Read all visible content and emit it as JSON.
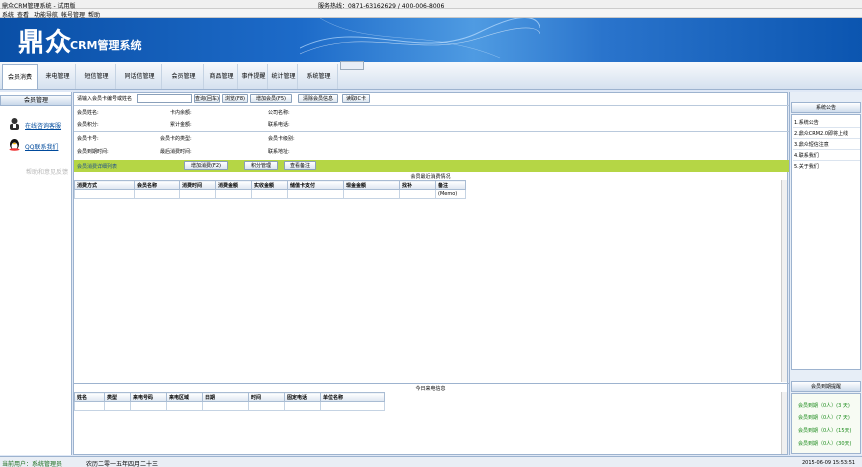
{
  "window": {
    "title": "鼎众CRM管理系统 - 试用版",
    "hotline": "服务热线：0871-63162629 / 400-006-8006"
  },
  "menu": [
    "系统",
    "查看",
    "功能导航",
    "帐号管理",
    "帮助"
  ],
  "banner": {
    "logo_cn": "鼎众",
    "logo_en": "CRM管理系统"
  },
  "tabs": [
    "会员消费",
    "来电管理",
    "短信管理",
    "同话信管理",
    "会员管理",
    "商品管理",
    "事件提醒",
    "统计管理",
    "系统管理"
  ],
  "left": {
    "header": "会员管理",
    "online_service": "在线咨询客服",
    "qq_contact": "QQ联系我们",
    "extra": "帮助和意见反馈"
  },
  "main": {
    "search_label": "请输入会员卡编号或姓名",
    "search_value": "",
    "buttons": {
      "query": "查询(回车)",
      "refresh": "浏览(F8)",
      "add_member": "增加会员(F5)",
      "clear": "清除会员信息",
      "read_card": "读取IC卡"
    },
    "info_row1": {
      "name": "会员姓名:",
      "balance": "卡内余额:",
      "company": "公司名称:"
    },
    "info_row2": {
      "points": "会员积分:",
      "total": "累计金额:",
      "phone": "联系电话:"
    },
    "info_row3": {
      "card_no": "会员卡号:",
      "card_type": "会员卡的类型:",
      "card_level": "会员卡级别:"
    },
    "info_row4": {
      "expire": "会员到期时间:",
      "last_time": "最后消费时间:",
      "address": "联系地址:"
    },
    "consume_list_title": "会员消费详细列表",
    "consume_buttons": {
      "add": "增加消费(F2)",
      "points_mgmt": "积分管理",
      "view_note": "查看备注"
    },
    "consume_grid_title": "会员最近消费情况",
    "consume_columns": [
      "消费方式",
      "会员名称",
      "消费时间",
      "消费金额",
      "实收金额",
      "储值卡支付",
      "现金金额",
      "找补",
      "备注"
    ],
    "consume_row": [
      "",
      "",
      "",
      "",
      "",
      "",
      "",
      "",
      "(Memo)"
    ],
    "calls_grid_title": "今日来电信息",
    "calls_columns": [
      "姓名",
      "类型",
      "来电号码",
      "来电区域",
      "日期",
      "时间",
      "固定电话",
      "单位名称"
    ]
  },
  "right": {
    "notice_header": "系统公告",
    "notices": [
      "1.系统公告",
      "2.鼎众CRM2.0即将上线",
      "3.鼎众短信注意",
      "4.联系我们",
      "5.关于我们"
    ],
    "expiry_header": "会员到期提醒",
    "expiry": [
      "会员到期（0人）(3 天)",
      "会员到期（0人）(7 天)",
      "会员到期（0人）(15天)",
      "会员到期（0人）(30天)"
    ]
  },
  "status": {
    "user": "当前用户：系统管理员",
    "lunar": "农历二零一五年四月二十三",
    "datetime": "2015-06-09 15:53:51"
  },
  "colors": {
    "banner": "#1d6bc9",
    "green_bar": "#b5d645",
    "accent_green": "#1a8a1a"
  }
}
